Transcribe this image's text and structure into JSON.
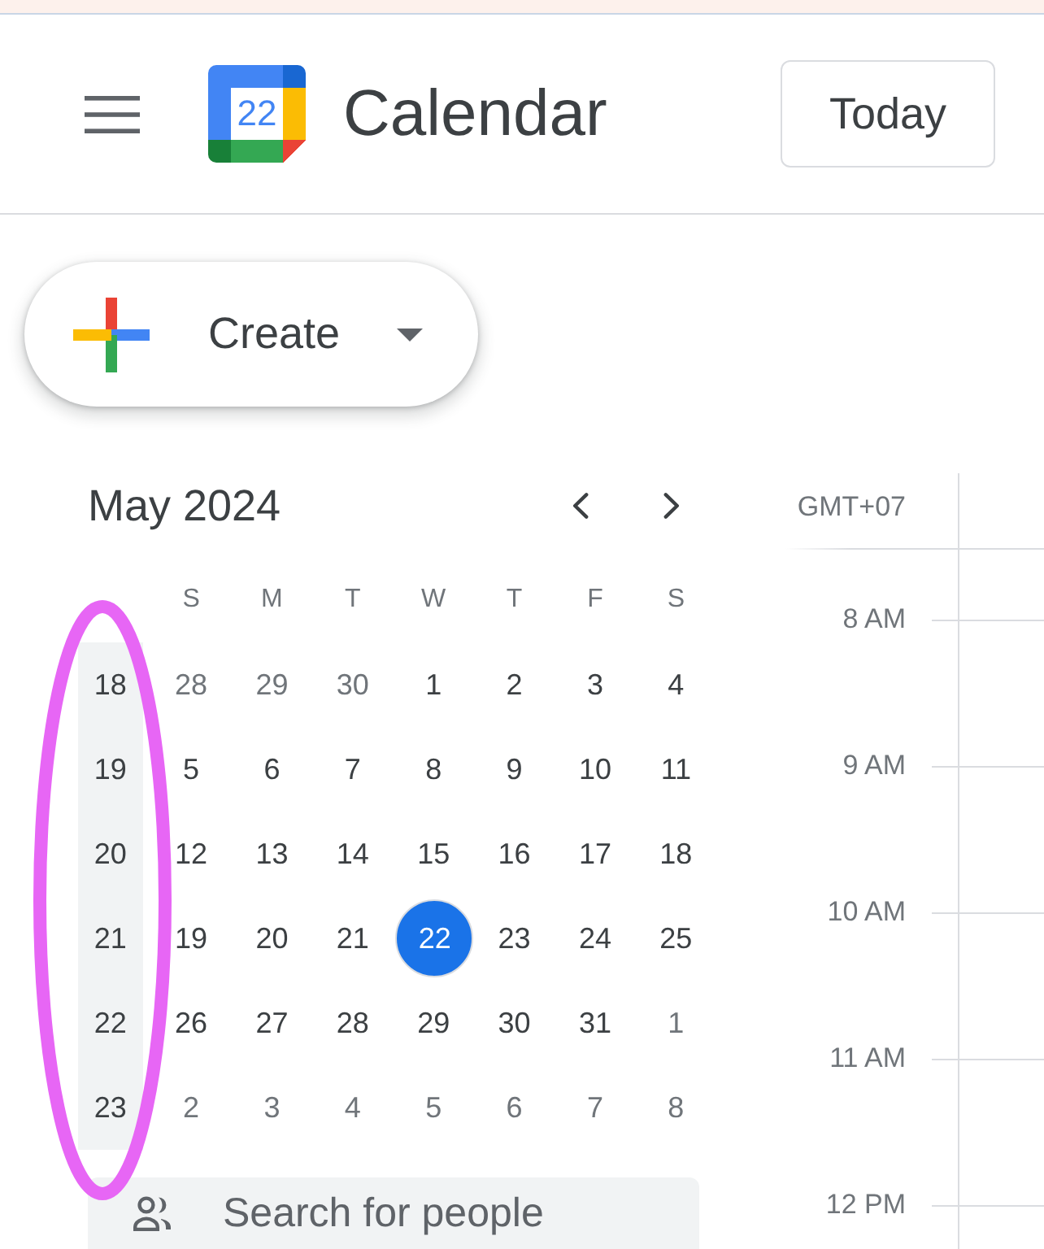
{
  "header": {
    "logo_text": "22",
    "title": "Calendar",
    "today_button": "Today"
  },
  "create_button": {
    "label": "Create"
  },
  "mini_calendar": {
    "month": "May 2024",
    "weekdays": [
      "S",
      "M",
      "T",
      "W",
      "T",
      "F",
      "S"
    ],
    "weeks": [
      {
        "number": "18",
        "days": [
          {
            "label": "28",
            "outside_month": true,
            "today": false
          },
          {
            "label": "29",
            "outside_month": true,
            "today": false
          },
          {
            "label": "30",
            "outside_month": true,
            "today": false
          },
          {
            "label": "1",
            "outside_month": false,
            "today": false
          },
          {
            "label": "2",
            "outside_month": false,
            "today": false
          },
          {
            "label": "3",
            "outside_month": false,
            "today": false
          },
          {
            "label": "4",
            "outside_month": false,
            "today": false
          }
        ]
      },
      {
        "number": "19",
        "days": [
          {
            "label": "5",
            "outside_month": false,
            "today": false
          },
          {
            "label": "6",
            "outside_month": false,
            "today": false
          },
          {
            "label": "7",
            "outside_month": false,
            "today": false
          },
          {
            "label": "8",
            "outside_month": false,
            "today": false
          },
          {
            "label": "9",
            "outside_month": false,
            "today": false
          },
          {
            "label": "10",
            "outside_month": false,
            "today": false
          },
          {
            "label": "11",
            "outside_month": false,
            "today": false
          }
        ]
      },
      {
        "number": "20",
        "days": [
          {
            "label": "12",
            "outside_month": false,
            "today": false
          },
          {
            "label": "13",
            "outside_month": false,
            "today": false
          },
          {
            "label": "14",
            "outside_month": false,
            "today": false
          },
          {
            "label": "15",
            "outside_month": false,
            "today": false
          },
          {
            "label": "16",
            "outside_month": false,
            "today": false
          },
          {
            "label": "17",
            "outside_month": false,
            "today": false
          },
          {
            "label": "18",
            "outside_month": false,
            "today": false
          }
        ]
      },
      {
        "number": "21",
        "days": [
          {
            "label": "19",
            "outside_month": false,
            "today": false
          },
          {
            "label": "20",
            "outside_month": false,
            "today": false
          },
          {
            "label": "21",
            "outside_month": false,
            "today": false
          },
          {
            "label": "22",
            "outside_month": false,
            "today": true
          },
          {
            "label": "23",
            "outside_month": false,
            "today": false
          },
          {
            "label": "24",
            "outside_month": false,
            "today": false
          },
          {
            "label": "25",
            "outside_month": false,
            "today": false
          }
        ]
      },
      {
        "number": "22",
        "days": [
          {
            "label": "26",
            "outside_month": false,
            "today": false
          },
          {
            "label": "27",
            "outside_month": false,
            "today": false
          },
          {
            "label": "28",
            "outside_month": false,
            "today": false
          },
          {
            "label": "29",
            "outside_month": false,
            "today": false
          },
          {
            "label": "30",
            "outside_month": false,
            "today": false
          },
          {
            "label": "31",
            "outside_month": false,
            "today": false
          },
          {
            "label": "1",
            "outside_month": true,
            "today": false
          }
        ]
      },
      {
        "number": "23",
        "days": [
          {
            "label": "2",
            "outside_month": true,
            "today": false
          },
          {
            "label": "3",
            "outside_month": true,
            "today": false
          },
          {
            "label": "4",
            "outside_month": true,
            "today": false
          },
          {
            "label": "5",
            "outside_month": true,
            "today": false
          },
          {
            "label": "6",
            "outside_month": true,
            "today": false
          },
          {
            "label": "7",
            "outside_month": true,
            "today": false
          },
          {
            "label": "8",
            "outside_month": true,
            "today": false
          }
        ]
      }
    ]
  },
  "people_search": {
    "placeholder": "Search for people"
  },
  "time_grid": {
    "timezone": "GMT+07",
    "hours": [
      "8 AM",
      "9 AM",
      "10 AM",
      "11 AM",
      "12 PM"
    ]
  }
}
